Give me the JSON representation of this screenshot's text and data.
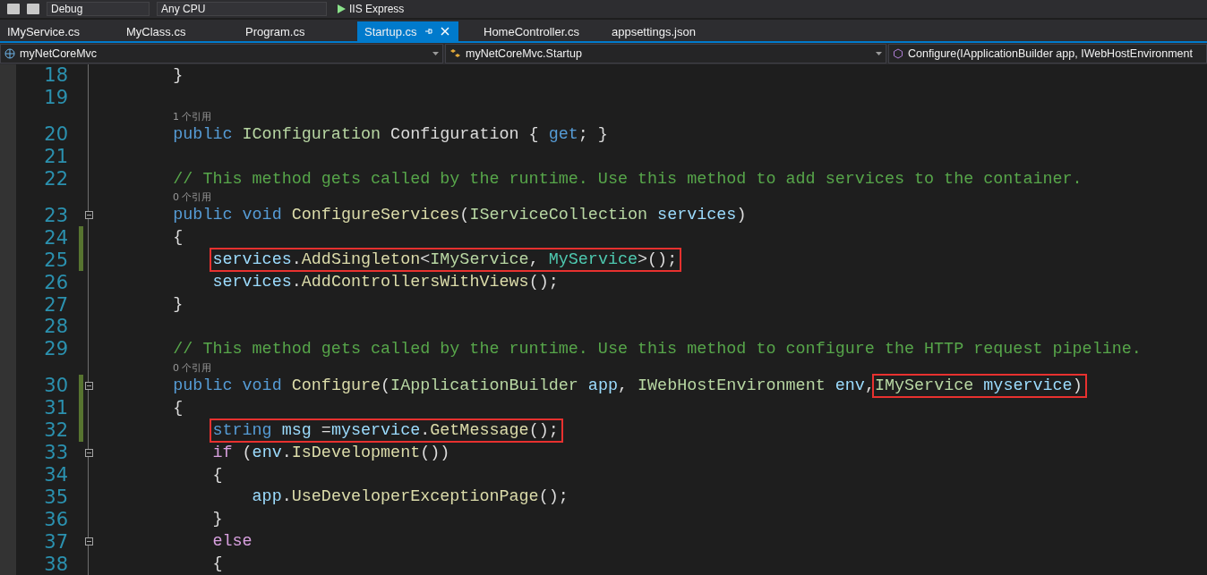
{
  "toolbar": {
    "configuration": "Debug",
    "platform": "Any CPU",
    "run": "IIS Express"
  },
  "tabs": [
    {
      "label": "IMyService.cs",
      "selected": false
    },
    {
      "label": "MyClass.cs",
      "selected": false
    },
    {
      "label": "Program.cs",
      "selected": false
    },
    {
      "label": "Startup.cs",
      "selected": true
    },
    {
      "label": "HomeController.cs",
      "selected": false
    },
    {
      "label": "appsettings.json",
      "selected": false
    }
  ],
  "navigation": {
    "project": "myNetCoreMvc",
    "type": "myNetCoreMvc.Startup",
    "member": "Configure(IApplicationBuilder app, IWebHostEnvironment"
  },
  "lines": [
    {
      "number": "18",
      "changed": false,
      "fold": false,
      "parts": [
        {
          "boxed": false,
          "tokens": [
            {
              "kind": "plain",
              "text": "        }"
            }
          ]
        }
      ]
    },
    {
      "number": "19",
      "changed": false,
      "fold": false
    },
    {
      "number": "20",
      "references": "1 个引用",
      "changed": false,
      "fold": false,
      "parts": [
        {
          "boxed": false,
          "tokens": [
            {
              "kind": "keyword",
              "text": "        public "
            },
            {
              "kind": "interface",
              "text": "IConfiguration"
            },
            {
              "kind": "plain",
              "text": " Configuration { "
            },
            {
              "kind": "keyword",
              "text": "get"
            },
            {
              "kind": "plain",
              "text": "; }"
            }
          ]
        }
      ]
    },
    {
      "number": "21",
      "changed": false,
      "fold": false
    },
    {
      "number": "22",
      "changed": false,
      "fold": false,
      "parts": [
        {
          "boxed": false,
          "tokens": [
            {
              "kind": "comment",
              "text": "        // This method gets called by the runtime. Use this method to add services to the container."
            }
          ]
        }
      ]
    },
    {
      "number": "23",
      "references": "0 个引用",
      "changed": false,
      "fold": true,
      "parts": [
        {
          "boxed": false,
          "tokens": [
            {
              "kind": "keyword",
              "text": "        public void "
            },
            {
              "kind": "method",
              "text": "ConfigureServices"
            },
            {
              "kind": "plain",
              "text": "("
            },
            {
              "kind": "interface",
              "text": "IServiceCollection "
            },
            {
              "kind": "variable",
              "text": "services"
            },
            {
              "kind": "plain",
              "text": ")"
            }
          ]
        }
      ]
    },
    {
      "number": "24",
      "changed": true,
      "fold": false,
      "parts": [
        {
          "boxed": false,
          "tokens": [
            {
              "kind": "plain",
              "text": "        {"
            }
          ]
        }
      ]
    },
    {
      "number": "25",
      "changed": true,
      "fold": false,
      "parts": [
        {
          "boxed": true,
          "tokens": [
            {
              "kind": "variable",
              "text": "            services"
            },
            {
              "kind": "plain",
              "text": "."
            },
            {
              "kind": "method",
              "text": "AddSingleton"
            },
            {
              "kind": "plain",
              "text": "<"
            },
            {
              "kind": "interface",
              "text": "IMyService"
            },
            {
              "kind": "plain",
              "text": ", "
            },
            {
              "kind": "class",
              "text": "MyService"
            },
            {
              "kind": "plain",
              "text": ">();"
            }
          ]
        }
      ]
    },
    {
      "number": "26",
      "changed": false,
      "fold": false,
      "parts": [
        {
          "boxed": false,
          "tokens": [
            {
              "kind": "variable",
              "text": "            services"
            },
            {
              "kind": "plain",
              "text": "."
            },
            {
              "kind": "method",
              "text": "AddControllersWithViews"
            },
            {
              "kind": "plain",
              "text": "();"
            }
          ]
        }
      ]
    },
    {
      "number": "27",
      "changed": false,
      "fold": false,
      "parts": [
        {
          "boxed": false,
          "tokens": [
            {
              "kind": "plain",
              "text": "        }"
            }
          ]
        }
      ]
    },
    {
      "number": "28",
      "changed": false,
      "fold": false
    },
    {
      "number": "29",
      "changed": false,
      "fold": false,
      "parts": [
        {
          "boxed": false,
          "tokens": [
            {
              "kind": "comment",
              "text": "        // This method gets called by the runtime. Use this method to configure the HTTP request pipeline."
            }
          ]
        }
      ]
    },
    {
      "number": "30",
      "references": "0 个引用",
      "changed": true,
      "fold": true,
      "parts": [
        {
          "boxed": false,
          "tokens": [
            {
              "kind": "keyword",
              "text": "        public void "
            },
            {
              "kind": "method",
              "text": "Configure"
            },
            {
              "kind": "plain",
              "text": "("
            },
            {
              "kind": "interface",
              "text": "IApplicationBuilder "
            },
            {
              "kind": "variable",
              "text": "app"
            },
            {
              "kind": "plain",
              "text": ", "
            },
            {
              "kind": "interface",
              "text": "IWebHostEnvironment "
            },
            {
              "kind": "variable",
              "text": "env"
            },
            {
              "kind": "plain",
              "text": ","
            }
          ]
        },
        {
          "boxed": true,
          "tokens": [
            {
              "kind": "interface",
              "text": "IMyService "
            },
            {
              "kind": "variable",
              "text": "myservice"
            },
            {
              "kind": "plain",
              "text": ")"
            }
          ]
        }
      ]
    },
    {
      "number": "31",
      "changed": true,
      "fold": false,
      "parts": [
        {
          "boxed": false,
          "tokens": [
            {
              "kind": "plain",
              "text": "        {"
            }
          ]
        }
      ]
    },
    {
      "number": "32",
      "changed": true,
      "fold": false,
      "parts": [
        {
          "boxed": true,
          "tokens": [
            {
              "kind": "keyword",
              "text": "            string "
            },
            {
              "kind": "variable",
              "text": "msg"
            },
            {
              "kind": "plain",
              "text": " ="
            },
            {
              "kind": "variable",
              "text": "myservice"
            },
            {
              "kind": "plain",
              "text": "."
            },
            {
              "kind": "method",
              "text": "GetMessage"
            },
            {
              "kind": "plain",
              "text": "();"
            }
          ]
        }
      ]
    },
    {
      "number": "33",
      "changed": false,
      "fold": true,
      "parts": [
        {
          "boxed": false,
          "tokens": [
            {
              "kind": "control",
              "text": "            if"
            },
            {
              "kind": "plain",
              "text": " ("
            },
            {
              "kind": "variable",
              "text": "env"
            },
            {
              "kind": "plain",
              "text": "."
            },
            {
              "kind": "method",
              "text": "IsDevelopment"
            },
            {
              "kind": "plain",
              "text": "())"
            }
          ]
        }
      ]
    },
    {
      "number": "34",
      "changed": false,
      "fold": false,
      "parts": [
        {
          "boxed": false,
          "tokens": [
            {
              "kind": "plain",
              "text": "            {"
            }
          ]
        }
      ]
    },
    {
      "number": "35",
      "changed": false,
      "fold": false,
      "parts": [
        {
          "boxed": false,
          "tokens": [
            {
              "kind": "variable",
              "text": "                app"
            },
            {
              "kind": "plain",
              "text": "."
            },
            {
              "kind": "method",
              "text": "UseDeveloperExceptionPage"
            },
            {
              "kind": "plain",
              "text": "();"
            }
          ]
        }
      ]
    },
    {
      "number": "36",
      "changed": false,
      "fold": false,
      "parts": [
        {
          "boxed": false,
          "tokens": [
            {
              "kind": "plain",
              "text": "            }"
            }
          ]
        }
      ]
    },
    {
      "number": "37",
      "changed": false,
      "fold": true,
      "parts": [
        {
          "boxed": false,
          "tokens": [
            {
              "kind": "control",
              "text": "            else"
            }
          ]
        }
      ]
    },
    {
      "number": "38",
      "changed": false,
      "fold": false,
      "parts": [
        {
          "boxed": false,
          "tokens": [
            {
              "kind": "plain",
              "text": "            {"
            }
          ]
        }
      ]
    }
  ]
}
